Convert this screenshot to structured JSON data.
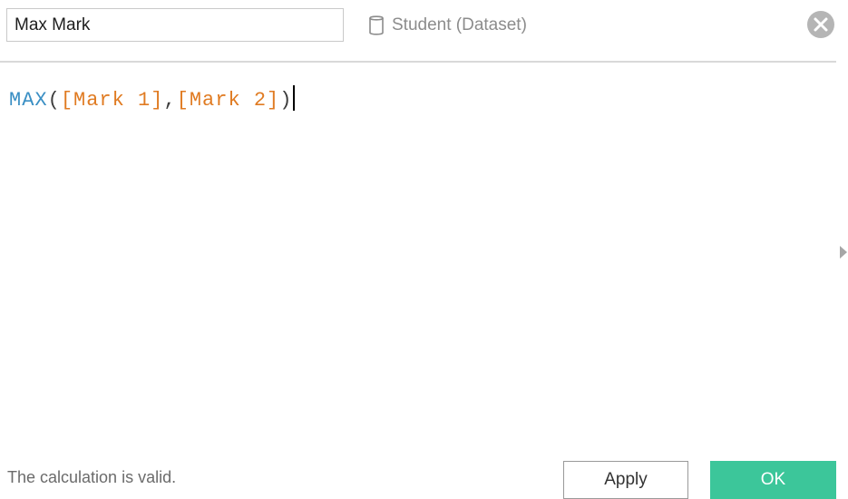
{
  "header": {
    "calc_name_value": "Max Mark",
    "datasource_icon": "database-icon",
    "datasource_label": "Student  (Dataset)",
    "close_icon": "close-circle-icon"
  },
  "editor": {
    "function_name": "MAX",
    "open_paren": "(",
    "field_1": "[Mark 1]",
    "comma": ",",
    "field_2": "[Mark 2]",
    "close_paren": ")"
  },
  "footer": {
    "status_text": "The calculation is valid.",
    "apply_label": "Apply",
    "ok_label": "OK"
  },
  "colors": {
    "function": "#3a8fc4",
    "field": "#e07b22",
    "ok_button": "#3cc69a",
    "close_icon": "#b5b5b5"
  },
  "side_toggle_icon": "expand-right-icon"
}
